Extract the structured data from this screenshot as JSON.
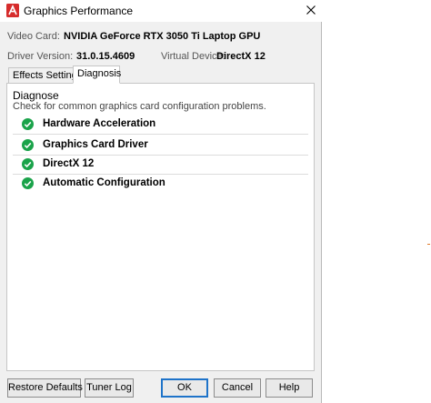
{
  "window": {
    "title": "Graphics Performance",
    "app_icon": "autodesk-a-logo-icon",
    "close_icon": "close-icon"
  },
  "info": {
    "video_card_label": "Video Card:",
    "video_card_value": "NVIDIA GeForce RTX 3050 Ti Laptop GPU",
    "driver_version_label": "Driver Version:",
    "driver_version_value": "31.0.15.4609",
    "virtual_device_label": "Virtual Device:",
    "virtual_device_value": "DirectX 12"
  },
  "tabs": [
    {
      "label": "Effects Settings",
      "active": false
    },
    {
      "label": "Diagnosis",
      "active": true
    }
  ],
  "diagnose": {
    "heading": "Diagnose",
    "description": "Check for common graphics card configuration problems.",
    "checks": [
      {
        "label": "Hardware Acceleration",
        "status": "ok"
      },
      {
        "label": "Graphics Card Driver",
        "status": "ok"
      },
      {
        "label": "DirectX 12",
        "status": "ok"
      },
      {
        "label": "Automatic Configuration",
        "status": "ok"
      }
    ],
    "status_icon": "green-check-circle-icon"
  },
  "buttons": {
    "restore_defaults": "Restore Defaults",
    "tuner_log": "Tuner Log",
    "ok": "OK",
    "cancel": "Cancel",
    "help": "Help"
  },
  "colors": {
    "accent": "#1e73c9",
    "check_green": "#1aa34a",
    "brand_red": "#d62c2c"
  }
}
